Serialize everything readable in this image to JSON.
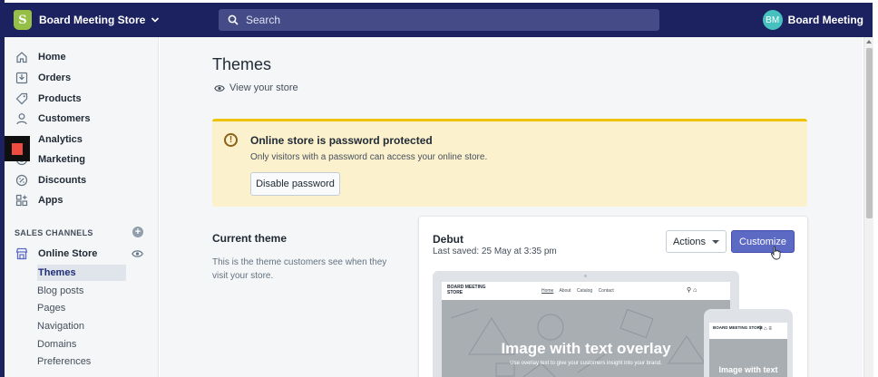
{
  "topbar": {
    "store_name": "Board Meeting Store",
    "search_placeholder": "Search",
    "avatar_initials": "BM",
    "account_name": "Board Meeting",
    "colors": {
      "bar": "#1c2260",
      "search": "#444b86",
      "avatar": "#47c1bf",
      "logo": "#95bf47"
    }
  },
  "sidebar": {
    "items": [
      {
        "label": "Home",
        "icon": "home-icon"
      },
      {
        "label": "Orders",
        "icon": "orders-icon"
      },
      {
        "label": "Products",
        "icon": "tag-icon"
      },
      {
        "label": "Customers",
        "icon": "person-icon"
      },
      {
        "label": "Analytics",
        "icon": "bar-chart-icon"
      },
      {
        "label": "Marketing",
        "icon": "target-icon"
      },
      {
        "label": "Discounts",
        "icon": "discount-icon"
      },
      {
        "label": "Apps",
        "icon": "apps-icon"
      }
    ],
    "sales_channels_title": "SALES CHANNELS",
    "online_store_label": "Online Store",
    "sub_items": [
      "Themes",
      "Blog posts",
      "Pages",
      "Navigation",
      "Domains",
      "Preferences"
    ]
  },
  "main": {
    "title": "Themes",
    "view_store": "View your store",
    "banner": {
      "title": "Online store is password protected",
      "body": "Only visitors with a password can access your online store.",
      "button": "Disable password"
    },
    "current_theme": {
      "title": "Current theme",
      "description": "This is the theme customers see when they visit your store."
    },
    "theme_card": {
      "name": "Debut",
      "saved": "Last saved: 25 May at 3:35 pm",
      "actions_label": "Actions",
      "customize_label": "Customize",
      "preview": {
        "logo": "BOARD MEETING STORE",
        "links": [
          "Home",
          "About",
          "Catalog",
          "Contact"
        ],
        "hero_title": "Image with text overlay",
        "hero_sub": "Use overlay text to give your customers insight into your brand."
      },
      "mobile_preview": {
        "logo": "BOARD MEETING STORE",
        "hero_title": "Image with text"
      }
    }
  }
}
